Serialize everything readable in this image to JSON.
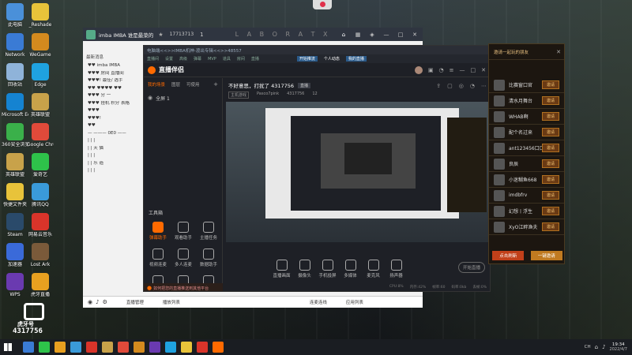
{
  "desktop": {
    "icons": [
      {
        "label": "此电脑",
        "color": "#4a90d9"
      },
      {
        "label": "_Reshade",
        "color": "#e8c33a"
      },
      {
        "label": "Network",
        "color": "#3a7bd5"
      },
      {
        "label": "WeGame",
        "color": "#d48a1e"
      },
      {
        "label": "回收站",
        "color": "#8fb3d9"
      },
      {
        "label": "Edge",
        "color": "#1fa2e0"
      },
      {
        "label": "Microsoft Edge",
        "color": "#1583d1"
      },
      {
        "label": "英雄联盟",
        "color": "#c8a24a"
      },
      {
        "label": "360安全浏览器",
        "color": "#3ab04a"
      },
      {
        "label": "Google Chrome",
        "color": "#e04a3a"
      },
      {
        "label": "英雄联盟",
        "color": "#c8a24a"
      },
      {
        "label": "爱奇艺",
        "color": "#2ec24a"
      },
      {
        "label": "快捷文件夹",
        "color": "#e8c33a"
      },
      {
        "label": "腾讯QQ",
        "color": "#3a9ad9"
      },
      {
        "label": "Steam",
        "color": "#2a4a6a"
      },
      {
        "label": "网易云音乐",
        "color": "#d9342a"
      },
      {
        "label": "加速器",
        "color": "#3a6ad9"
      },
      {
        "label": "Lost Ark",
        "color": "#7a5a3a"
      },
      {
        "label": "WPS",
        "color": "#6a3ab0"
      },
      {
        "label": "虎牙直播",
        "color": "#e8a020"
      }
    ]
  },
  "qq_window": {
    "title": "imba IMBA 谁是最菜的",
    "room_id": "17713713",
    "badge": "1",
    "letters": "L A B O R A T X",
    "side_label": "最新消息",
    "chat_lines": [
      "♥♥  imba  IMBA",
      "♥♥♥ 房间 直播间",
      "♥♥♥!  最佳/ 选手",
      "♥♥  ♥♥♥♥ ♥♥",
      "♥♥♥ 分 一",
      "♥♥♥  挂机  积分  表格",
      "♥♥♥",
      "♥♥♥!",
      "♥♥",
      "—  ———  0E0  ——",
      "|   |      |",
      "|   |     天 猫",
      "|   |      |",
      "|   |     乐 造",
      "|   |      |"
    ],
    "bottom_tabs": [
      "直播管理",
      "播放列表",
      "连麦连线",
      "应用列表"
    ]
  },
  "streamer_app": {
    "breadcrumb": "电脑端<<>>IMBA机神-渡出专辑<<>>48557",
    "top_tabs": [
      "直播间",
      "设置",
      "高级",
      "弹幕",
      "MVP",
      "道具",
      "房间",
      "直播",
      "开始推流",
      "个人动态",
      "我的直播"
    ],
    "app_name": "直播伴侣",
    "left_tabs": [
      "我的场景",
      "图层",
      "可使用"
    ],
    "scene_label": "全屏 1",
    "room_title": "不好意思，打扰了 4317756",
    "room_tag": "直播",
    "room_meta": [
      "主机游戏",
      "Pasco7pink",
      "4317756",
      "12"
    ],
    "tools_header": "工具箱",
    "tools": [
      {
        "label": "弹幕助手",
        "active": true
      },
      {
        "label": "观看助手",
        "active": false
      },
      {
        "label": "主播任务",
        "active": false
      },
      {
        "label": "视频连麦",
        "active": false
      },
      {
        "label": "多人连麦",
        "active": false
      },
      {
        "label": "数据助手",
        "active": false
      },
      {
        "label": "虚拟形象",
        "active": false
      },
      {
        "label": "弹幕姬",
        "active": false
      },
      {
        "label": "歌词助手",
        "active": false
      }
    ],
    "bottom_note": "如何把您的直播推送到其他平台",
    "source_buttons": [
      "直播画面",
      "摄像头",
      "手机投屏",
      "多媒体",
      "麦克风",
      "扬声器"
    ],
    "start_button": "开始直播",
    "status_items": [
      "CPU:8%",
      "内存:42%",
      "帧率:60",
      "码率:0kb",
      "丢帧:0%"
    ]
  },
  "friends_panel": {
    "header": "邀请一起玩的朋友",
    "invite_label": "邀请",
    "friends": [
      "比赛窗口官",
      "清水月舞台",
      "WHAB啊",
      "配个名过来",
      "ant123456口口",
      "良辰",
      "小迷糊鱼668",
      "imdbfrv",
      "幻想丨浮生",
      "XyO江畔渔夫"
    ],
    "refresh_button": "点击刷新",
    "invite_all_button": "一键邀请"
  },
  "overlay": {
    "brand": "虎牙号",
    "room_number": "4317756"
  },
  "taskbar": {
    "time": "19:34",
    "date": "2022/4/7",
    "tray_label": "CH"
  },
  "colors": {
    "accent_orange": "#ff6a00",
    "invite_bg": "#6a3a14",
    "app_dark": "#1e2026"
  }
}
